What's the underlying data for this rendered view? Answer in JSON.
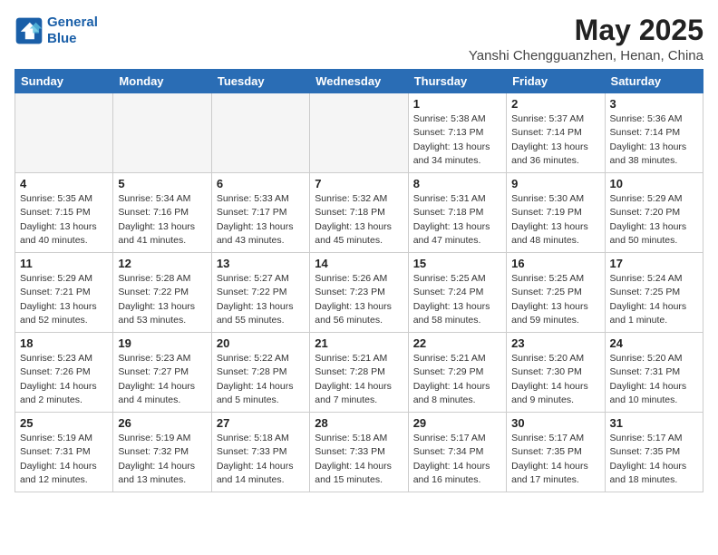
{
  "header": {
    "logo_line1": "General",
    "logo_line2": "Blue",
    "month_year": "May 2025",
    "location": "Yanshi Chengguanzhen, Henan, China"
  },
  "weekdays": [
    "Sunday",
    "Monday",
    "Tuesday",
    "Wednesday",
    "Thursday",
    "Friday",
    "Saturday"
  ],
  "weeks": [
    [
      {
        "day": "",
        "empty": true
      },
      {
        "day": "",
        "empty": true
      },
      {
        "day": "",
        "empty": true
      },
      {
        "day": "",
        "empty": true
      },
      {
        "day": "1",
        "sunrise": "5:38 AM",
        "sunset": "7:13 PM",
        "daylight": "13 hours and 34 minutes."
      },
      {
        "day": "2",
        "sunrise": "5:37 AM",
        "sunset": "7:14 PM",
        "daylight": "13 hours and 36 minutes."
      },
      {
        "day": "3",
        "sunrise": "5:36 AM",
        "sunset": "7:14 PM",
        "daylight": "13 hours and 38 minutes."
      }
    ],
    [
      {
        "day": "4",
        "sunrise": "5:35 AM",
        "sunset": "7:15 PM",
        "daylight": "13 hours and 40 minutes."
      },
      {
        "day": "5",
        "sunrise": "5:34 AM",
        "sunset": "7:16 PM",
        "daylight": "13 hours and 41 minutes."
      },
      {
        "day": "6",
        "sunrise": "5:33 AM",
        "sunset": "7:17 PM",
        "daylight": "13 hours and 43 minutes."
      },
      {
        "day": "7",
        "sunrise": "5:32 AM",
        "sunset": "7:18 PM",
        "daylight": "13 hours and 45 minutes."
      },
      {
        "day": "8",
        "sunrise": "5:31 AM",
        "sunset": "7:18 PM",
        "daylight": "13 hours and 47 minutes."
      },
      {
        "day": "9",
        "sunrise": "5:30 AM",
        "sunset": "7:19 PM",
        "daylight": "13 hours and 48 minutes."
      },
      {
        "day": "10",
        "sunrise": "5:29 AM",
        "sunset": "7:20 PM",
        "daylight": "13 hours and 50 minutes."
      }
    ],
    [
      {
        "day": "11",
        "sunrise": "5:29 AM",
        "sunset": "7:21 PM",
        "daylight": "13 hours and 52 minutes."
      },
      {
        "day": "12",
        "sunrise": "5:28 AM",
        "sunset": "7:22 PM",
        "daylight": "13 hours and 53 minutes."
      },
      {
        "day": "13",
        "sunrise": "5:27 AM",
        "sunset": "7:22 PM",
        "daylight": "13 hours and 55 minutes."
      },
      {
        "day": "14",
        "sunrise": "5:26 AM",
        "sunset": "7:23 PM",
        "daylight": "13 hours and 56 minutes."
      },
      {
        "day": "15",
        "sunrise": "5:25 AM",
        "sunset": "7:24 PM",
        "daylight": "13 hours and 58 minutes."
      },
      {
        "day": "16",
        "sunrise": "5:25 AM",
        "sunset": "7:25 PM",
        "daylight": "13 hours and 59 minutes."
      },
      {
        "day": "17",
        "sunrise": "5:24 AM",
        "sunset": "7:25 PM",
        "daylight": "14 hours and 1 minute."
      }
    ],
    [
      {
        "day": "18",
        "sunrise": "5:23 AM",
        "sunset": "7:26 PM",
        "daylight": "14 hours and 2 minutes."
      },
      {
        "day": "19",
        "sunrise": "5:23 AM",
        "sunset": "7:27 PM",
        "daylight": "14 hours and 4 minutes."
      },
      {
        "day": "20",
        "sunrise": "5:22 AM",
        "sunset": "7:28 PM",
        "daylight": "14 hours and 5 minutes."
      },
      {
        "day": "21",
        "sunrise": "5:21 AM",
        "sunset": "7:28 PM",
        "daylight": "14 hours and 7 minutes."
      },
      {
        "day": "22",
        "sunrise": "5:21 AM",
        "sunset": "7:29 PM",
        "daylight": "14 hours and 8 minutes."
      },
      {
        "day": "23",
        "sunrise": "5:20 AM",
        "sunset": "7:30 PM",
        "daylight": "14 hours and 9 minutes."
      },
      {
        "day": "24",
        "sunrise": "5:20 AM",
        "sunset": "7:31 PM",
        "daylight": "14 hours and 10 minutes."
      }
    ],
    [
      {
        "day": "25",
        "sunrise": "5:19 AM",
        "sunset": "7:31 PM",
        "daylight": "14 hours and 12 minutes."
      },
      {
        "day": "26",
        "sunrise": "5:19 AM",
        "sunset": "7:32 PM",
        "daylight": "14 hours and 13 minutes."
      },
      {
        "day": "27",
        "sunrise": "5:18 AM",
        "sunset": "7:33 PM",
        "daylight": "14 hours and 14 minutes."
      },
      {
        "day": "28",
        "sunrise": "5:18 AM",
        "sunset": "7:33 PM",
        "daylight": "14 hours and 15 minutes."
      },
      {
        "day": "29",
        "sunrise": "5:17 AM",
        "sunset": "7:34 PM",
        "daylight": "14 hours and 16 minutes."
      },
      {
        "day": "30",
        "sunrise": "5:17 AM",
        "sunset": "7:35 PM",
        "daylight": "14 hours and 17 minutes."
      },
      {
        "day": "31",
        "sunrise": "5:17 AM",
        "sunset": "7:35 PM",
        "daylight": "14 hours and 18 minutes."
      }
    ]
  ]
}
